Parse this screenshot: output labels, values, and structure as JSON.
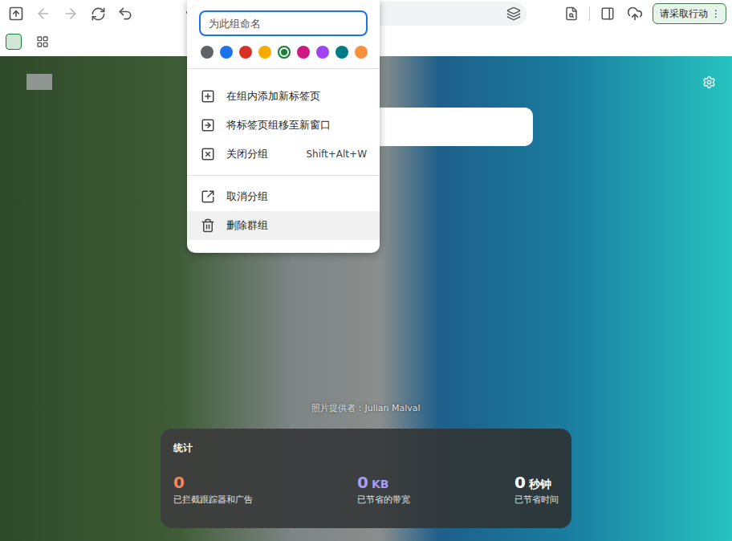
{
  "toolbar": {
    "nav": {
      "back": {
        "disabled": true
      },
      "forward": {
        "disabled": true
      }
    },
    "action_button": {
      "label": "请采取行动",
      "menu_glyph": "⋮"
    }
  },
  "tab_group_menu": {
    "name_placeholder": "为此组命名",
    "colors": [
      {
        "color": "#5f6368",
        "selected": false
      },
      {
        "color": "#1a73e8",
        "selected": false
      },
      {
        "color": "#d93025",
        "selected": false
      },
      {
        "color": "#f9ab00",
        "selected": false
      },
      {
        "color": "#188038",
        "selected": true
      },
      {
        "color": "#d01884",
        "selected": false
      },
      {
        "color": "#a142f4",
        "selected": false
      },
      {
        "color": "#007b83",
        "selected": false
      },
      {
        "color": "#fa903e",
        "selected": false
      }
    ],
    "sections": [
      [
        {
          "label": "在组内添加新标签页",
          "kind": "add",
          "hovered": false
        },
        {
          "label": "将标签页组移至新窗口",
          "kind": "move",
          "hovered": false
        },
        {
          "label": "关闭分组",
          "kind": "close",
          "shortcut": "Shift+Alt+W",
          "hovered": false
        }
      ],
      [
        {
          "label": "取消分组",
          "kind": "ungroup",
          "hovered": false
        },
        {
          "label": "删除群组",
          "kind": "delete",
          "hovered": true
        }
      ]
    ]
  },
  "new_tab_page": {
    "photo_credit": "照片提供者：Julian Malval",
    "stats": {
      "title": "统计",
      "items": [
        {
          "value": "0",
          "unit": "",
          "label": "已拦截跟踪器和广告",
          "color": "#f4845f"
        },
        {
          "value": "0",
          "unit": "KB",
          "label": "已节省的带宽",
          "color": "#a99cf5"
        },
        {
          "value": "0",
          "unit": "秒钟",
          "label": "已节省时间",
          "color": "#ffffff"
        }
      ]
    }
  }
}
